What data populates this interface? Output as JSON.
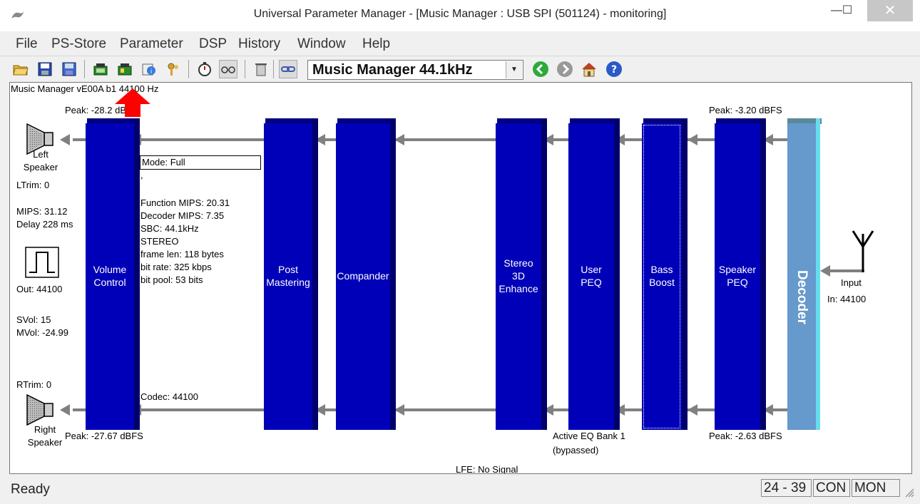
{
  "window": {
    "title": "Universal Parameter Manager - [Music Manager : USB SPI (501124) - monitoring]",
    "minimize": "—",
    "maximize": "☐",
    "close": "✕"
  },
  "menu": [
    "File",
    "PS-Store",
    "Parameter",
    "DSP",
    "History",
    "Window",
    "Help"
  ],
  "toolbar": {
    "config_select": "Music Manager 44.1kHz",
    "icons": [
      "open-folder-icon",
      "save-icon",
      "save-as-icon",
      "chip-read-icon",
      "chip-write-icon",
      "info-icon",
      "keys-icon",
      "stopwatch-icon",
      "glasses-icon",
      "trash-icon",
      "link-icon",
      "back-icon",
      "forward-icon",
      "home-icon",
      "help-icon"
    ]
  },
  "canvas": {
    "header": "Music Manager vE00A b1 44100 Hz",
    "peak_left": "Peak: -28.2 dBFS",
    "peak_right_out": "Peak: -27.67 dBFS",
    "peak_in_top": "Peak: -3.20 dBFS",
    "peak_in_bottom": "Peak: -2.63 dBFS",
    "left_speaker": "Left\nSpeaker",
    "right_speaker": "Right\nSpeaker",
    "ltrim": "LTrim: 0",
    "rtrim": "RTrim: 0",
    "mips": "MIPS: 31.12",
    "delay": "Delay 228 ms",
    "out": "Out: 44100",
    "svol": "SVol: 15",
    "mvol": "MVol: -24.99",
    "mode": "Mode: Full",
    "mode_dot": ",",
    "info_lines": [
      "Function MIPS: 20.31",
      "Decoder MIPS: 7.35",
      "SBC: 44.1kHz",
      "STEREO",
      "frame len: 118 bytes",
      "bit rate: 325 kbps",
      "bit pool: 53 bits"
    ],
    "codec": "Codec: 44100",
    "blocks": [
      "Volume\nControl",
      "Post\nMastering",
      "Compander",
      "Stereo\n3D\nEnhance",
      "User\nPEQ",
      "Bass\nBoost",
      "Speaker\nPEQ"
    ],
    "decoder": "Decoder",
    "input": "Input",
    "input_rate": "In: 44100",
    "eq_bank": "Active EQ Bank 1",
    "eq_bypassed": "(bypassed)",
    "lfe": "LFE: No Signal"
  },
  "status": {
    "ready": "Ready",
    "range": "24 - 39",
    "con": "CON",
    "mon": "MON"
  },
  "colors": {
    "block": "#0000b8",
    "decoder": "#6699cc",
    "arrow": "#808080",
    "highlight": "#ff0000"
  }
}
